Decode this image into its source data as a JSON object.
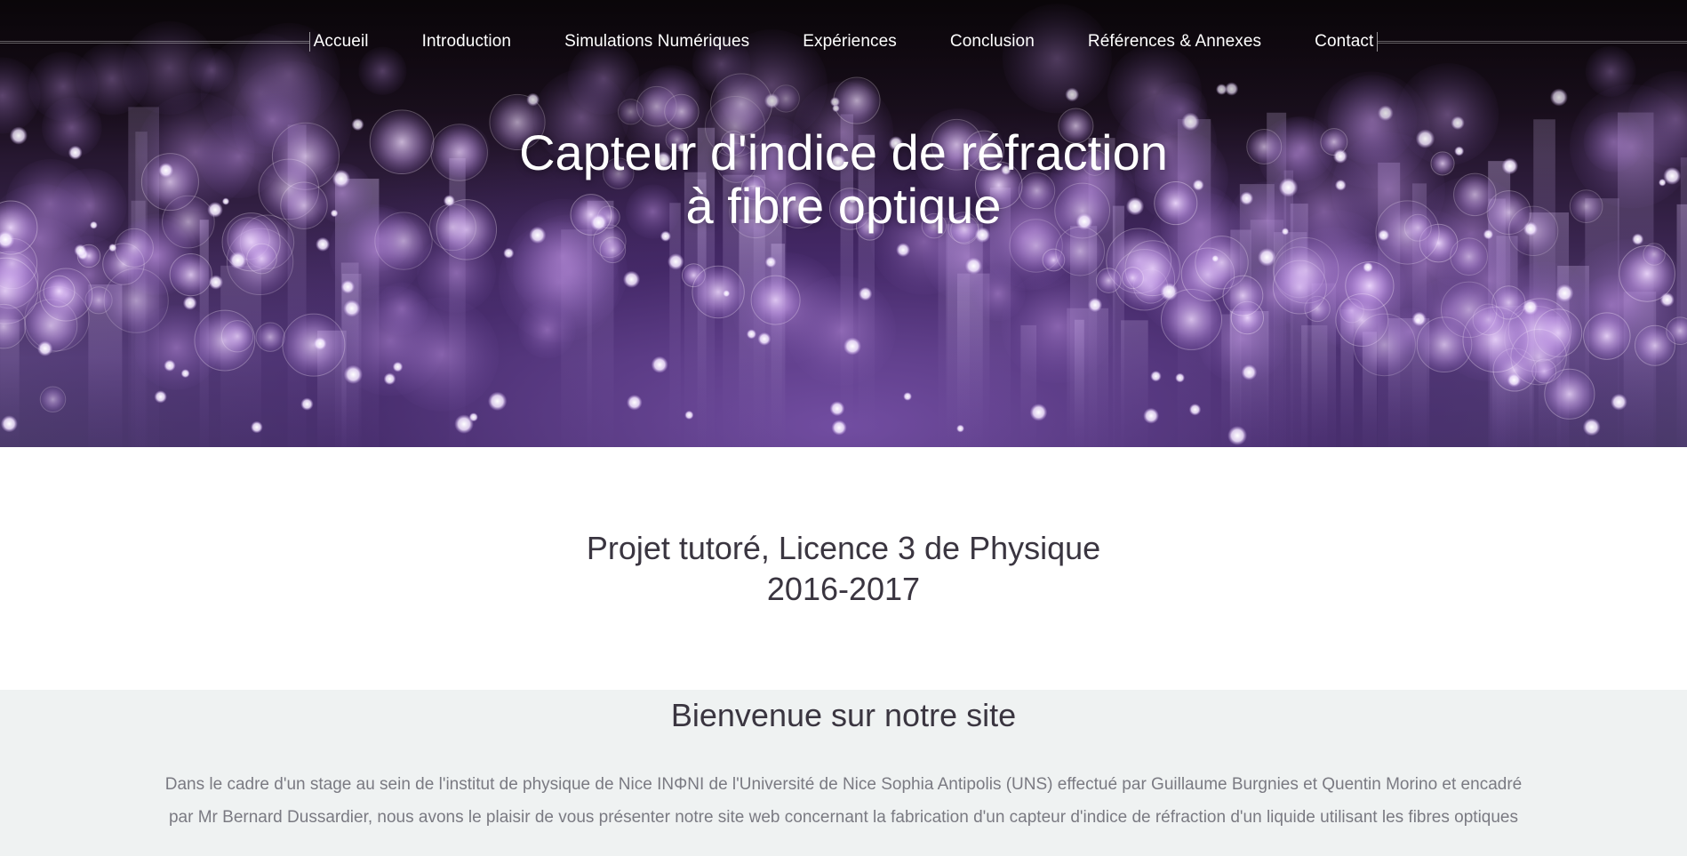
{
  "nav": {
    "items": [
      {
        "label": "Accueil"
      },
      {
        "label": "Introduction"
      },
      {
        "label": "Simulations Numériques"
      },
      {
        "label": "Expériences"
      },
      {
        "label": "Conclusion"
      },
      {
        "label": "Références & Annexes"
      },
      {
        "label": "Contact"
      }
    ]
  },
  "hero": {
    "title_line1": "Capteur d'indice de réfraction",
    "title_line2": "à fibre optique"
  },
  "project": {
    "line1": "Projet tutoré, Licence 3 de Physique",
    "line2": "2016-2017"
  },
  "welcome": {
    "title": "Bienvenue sur notre site",
    "text": "Dans le cadre d'un stage au sein de l'institut de physique de Nice INΦNI de l'Université de Nice Sophia Antipolis (UNS) effectué par Guillaume Burgnies et Quentin Morino et encadré par Mr Bernard Dussardier, nous avons le plaisir de vous présenter notre site web concernant la fabrication d'un capteur d'indice de réfraction d'un liquide utilisant les fibres optiques"
  },
  "colors": {
    "hero_purple": "#57407a",
    "text_dark": "#3a3540",
    "text_muted": "#7a7a82",
    "welcome_bg": "#eff2f2"
  }
}
